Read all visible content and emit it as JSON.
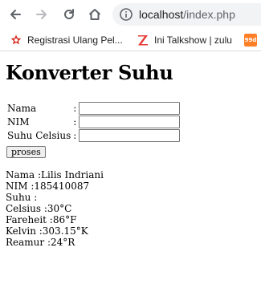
{
  "browser": {
    "url_host": "localhost",
    "url_path": "/index.php",
    "bookmarks": [
      {
        "label": "Registrasi Ulang Pel...",
        "icon": "star-bookmark-icon",
        "color": "#d93025"
      },
      {
        "label": "Ini Talkshow | zulu",
        "icon": "zulu-logo-icon",
        "color": "#e53935"
      },
      {
        "label": "99d",
        "icon": "99d-logo-icon",
        "color": "#ff7f27"
      }
    ]
  },
  "page": {
    "title": "Konverter Suhu",
    "form": {
      "nama_label": "Nama",
      "nim_label": "NIM",
      "suhu_label": "Suhu Celsius",
      "separator": ":",
      "nama_value": "",
      "nim_value": "",
      "suhu_value": "",
      "submit_label": "proses"
    },
    "result": [
      "Nama :Lilis Indriani",
      "NIM :185410087",
      "Suhu :",
      "Celsius :30°C",
      "Fareheit :86°F",
      "Kelvin :303.15°K",
      "Reamur :24°R"
    ]
  }
}
